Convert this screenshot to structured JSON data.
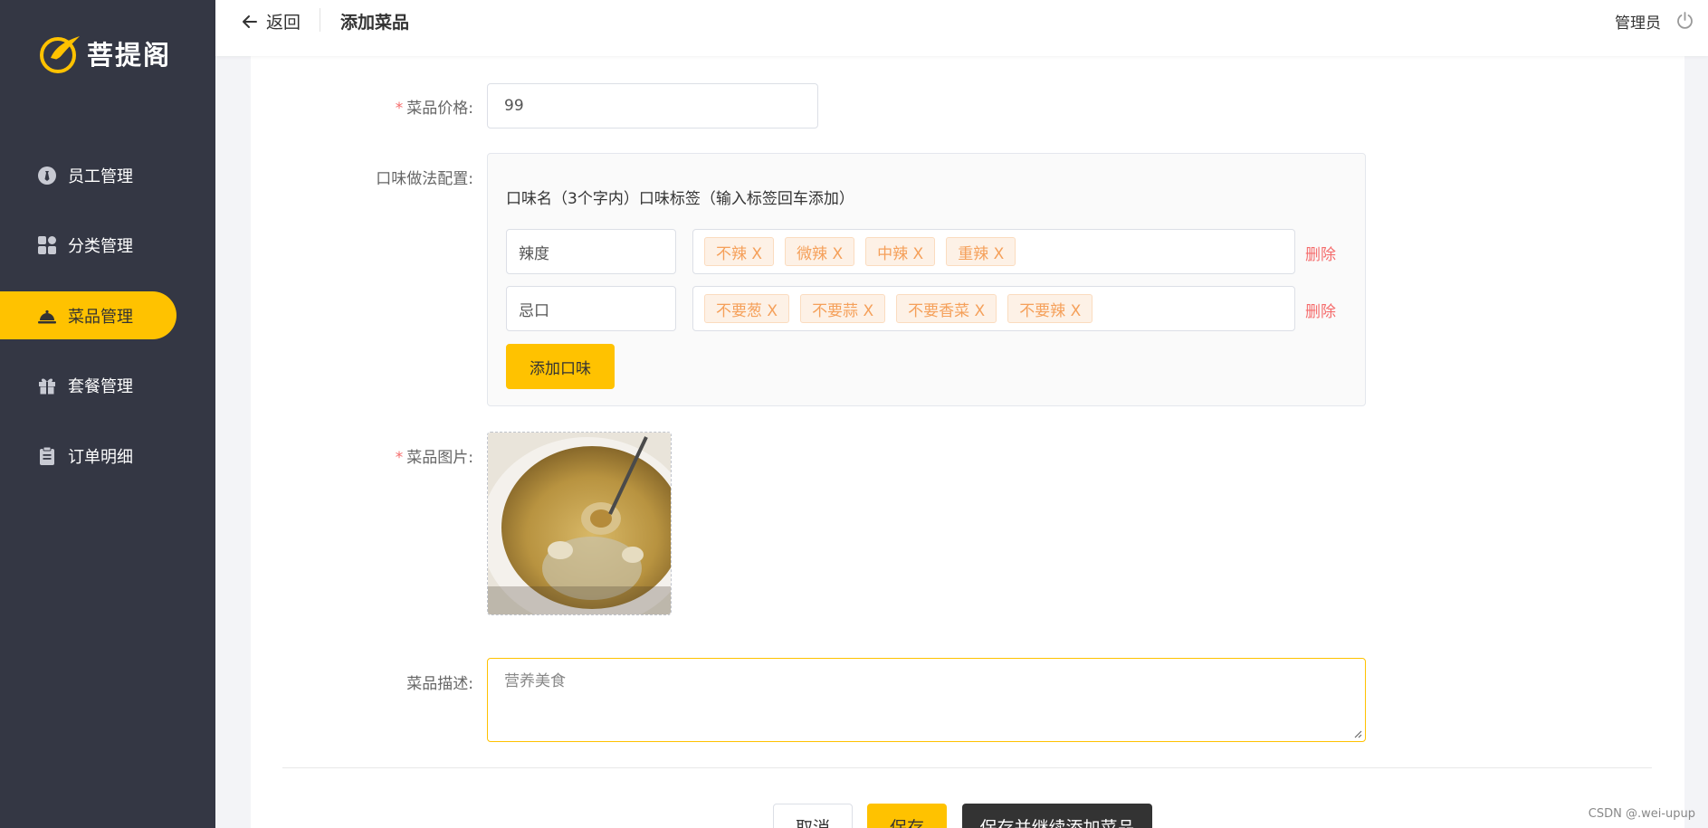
{
  "brand": {
    "name": "菩提阁",
    "accent": "#ffc200",
    "sidebar_bg": "#343744"
  },
  "sidebar": {
    "items": [
      {
        "label": "员工管理",
        "icon": "employee-icon"
      },
      {
        "label": "分类管理",
        "icon": "category-grid-icon"
      },
      {
        "label": "菜品管理",
        "icon": "dish-cloche-icon",
        "active": true
      },
      {
        "label": "套餐管理",
        "icon": "gift-icon"
      },
      {
        "label": "订单明细",
        "icon": "clipboard-icon"
      }
    ]
  },
  "header": {
    "back_label": "返回",
    "title": "添加菜品",
    "user": "管理员"
  },
  "form": {
    "price": {
      "label": "菜品价格:",
      "value": "99"
    },
    "flavor": {
      "label": "口味做法配置:",
      "head": "口味名（3个字内）口味标签（输入标签回车添加）",
      "rows": [
        {
          "name": "辣度",
          "tags": [
            "不辣 X",
            "微辣 X",
            "中辣 X",
            "重辣 X"
          ],
          "delete": "删除"
        },
        {
          "name": "忌口",
          "tags": [
            "不要葱 X",
            "不要蒜 X",
            "不要香菜 X",
            "不要辣 X"
          ],
          "delete": "删除"
        }
      ],
      "add_label": "添加口味"
    },
    "image": {
      "label": "菜品图片:"
    },
    "description": {
      "label": "菜品描述:",
      "value": "营养美食"
    }
  },
  "actions": {
    "cancel": "取消",
    "save": "保存",
    "save_and_add": "保存并继续添加菜品"
  },
  "watermark": "CSDN @.wei-upup"
}
